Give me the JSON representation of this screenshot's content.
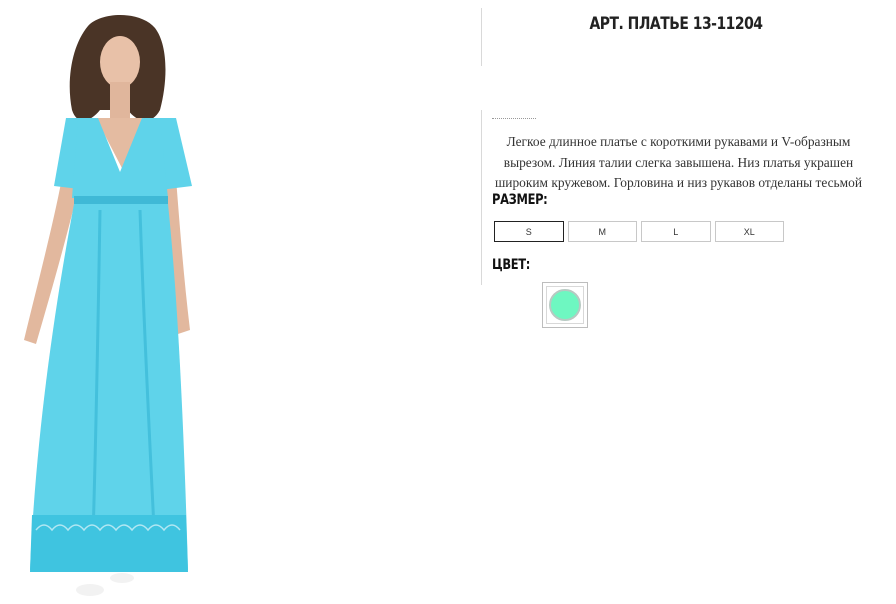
{
  "product": {
    "title": "АРТ. ПЛАТЬЕ 13-11204",
    "description": "Легкое длинное платье с короткими рукавами и V-образным вырезом. Линия талии слегка завышена. Низ платья украшен широким кружевом. Горловина и низ рукавов отделаны тесьмой",
    "image_icon": "dress-photo"
  },
  "size_selector": {
    "label": "РАЗМЕР:",
    "options": [
      "S",
      "M",
      "L",
      "XL"
    ],
    "selected": "S"
  },
  "color_selector": {
    "label": "ЦВЕТ:",
    "swatch_color": "#6ef7c1"
  },
  "colors": {
    "dress": "#5fd3ea",
    "dress_shadow": "#3fb9d6",
    "swatch": "#6ef7c1"
  }
}
